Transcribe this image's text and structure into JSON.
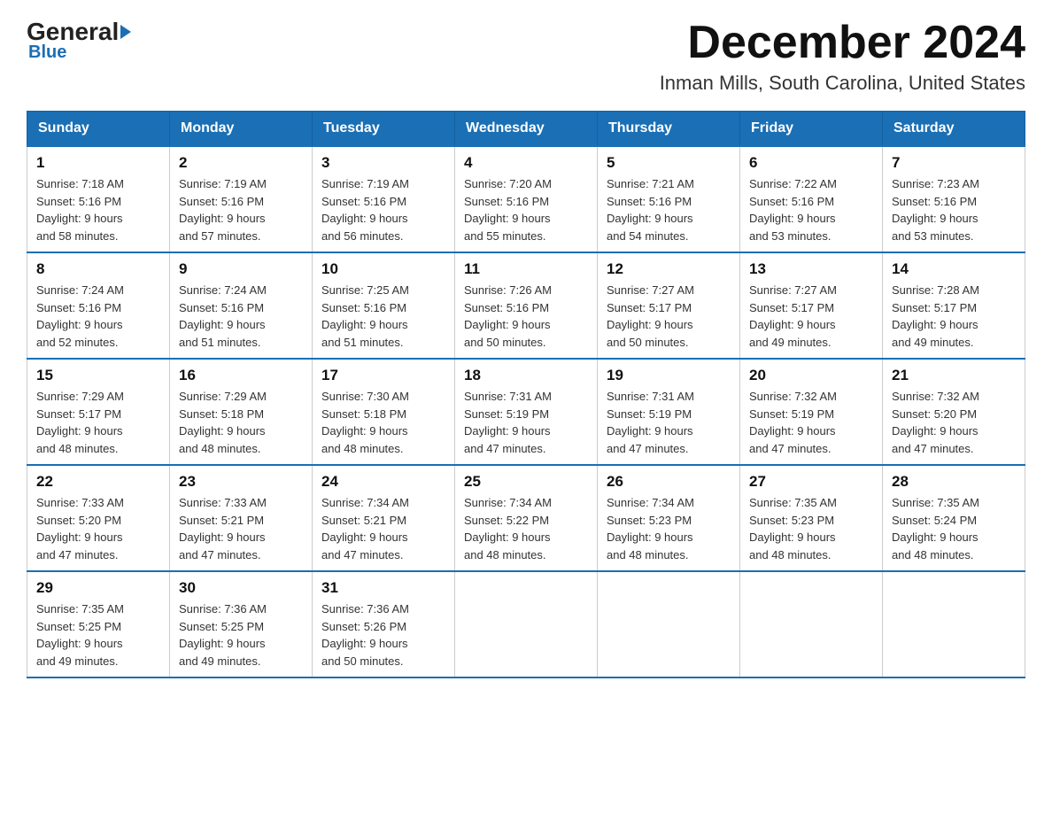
{
  "logo": {
    "general": "General",
    "blue": "Blue"
  },
  "header": {
    "month": "December 2024",
    "location": "Inman Mills, South Carolina, United States"
  },
  "days_of_week": [
    "Sunday",
    "Monday",
    "Tuesday",
    "Wednesday",
    "Thursday",
    "Friday",
    "Saturday"
  ],
  "weeks": [
    [
      {
        "day": "1",
        "sunrise": "7:18 AM",
        "sunset": "5:16 PM",
        "daylight": "9 hours and 58 minutes."
      },
      {
        "day": "2",
        "sunrise": "7:19 AM",
        "sunset": "5:16 PM",
        "daylight": "9 hours and 57 minutes."
      },
      {
        "day": "3",
        "sunrise": "7:19 AM",
        "sunset": "5:16 PM",
        "daylight": "9 hours and 56 minutes."
      },
      {
        "day": "4",
        "sunrise": "7:20 AM",
        "sunset": "5:16 PM",
        "daylight": "9 hours and 55 minutes."
      },
      {
        "day": "5",
        "sunrise": "7:21 AM",
        "sunset": "5:16 PM",
        "daylight": "9 hours and 54 minutes."
      },
      {
        "day": "6",
        "sunrise": "7:22 AM",
        "sunset": "5:16 PM",
        "daylight": "9 hours and 53 minutes."
      },
      {
        "day": "7",
        "sunrise": "7:23 AM",
        "sunset": "5:16 PM",
        "daylight": "9 hours and 53 minutes."
      }
    ],
    [
      {
        "day": "8",
        "sunrise": "7:24 AM",
        "sunset": "5:16 PM",
        "daylight": "9 hours and 52 minutes."
      },
      {
        "day": "9",
        "sunrise": "7:24 AM",
        "sunset": "5:16 PM",
        "daylight": "9 hours and 51 minutes."
      },
      {
        "day": "10",
        "sunrise": "7:25 AM",
        "sunset": "5:16 PM",
        "daylight": "9 hours and 51 minutes."
      },
      {
        "day": "11",
        "sunrise": "7:26 AM",
        "sunset": "5:16 PM",
        "daylight": "9 hours and 50 minutes."
      },
      {
        "day": "12",
        "sunrise": "7:27 AM",
        "sunset": "5:17 PM",
        "daylight": "9 hours and 50 minutes."
      },
      {
        "day": "13",
        "sunrise": "7:27 AM",
        "sunset": "5:17 PM",
        "daylight": "9 hours and 49 minutes."
      },
      {
        "day": "14",
        "sunrise": "7:28 AM",
        "sunset": "5:17 PM",
        "daylight": "9 hours and 49 minutes."
      }
    ],
    [
      {
        "day": "15",
        "sunrise": "7:29 AM",
        "sunset": "5:17 PM",
        "daylight": "9 hours and 48 minutes."
      },
      {
        "day": "16",
        "sunrise": "7:29 AM",
        "sunset": "5:18 PM",
        "daylight": "9 hours and 48 minutes."
      },
      {
        "day": "17",
        "sunrise": "7:30 AM",
        "sunset": "5:18 PM",
        "daylight": "9 hours and 48 minutes."
      },
      {
        "day": "18",
        "sunrise": "7:31 AM",
        "sunset": "5:19 PM",
        "daylight": "9 hours and 47 minutes."
      },
      {
        "day": "19",
        "sunrise": "7:31 AM",
        "sunset": "5:19 PM",
        "daylight": "9 hours and 47 minutes."
      },
      {
        "day": "20",
        "sunrise": "7:32 AM",
        "sunset": "5:19 PM",
        "daylight": "9 hours and 47 minutes."
      },
      {
        "day": "21",
        "sunrise": "7:32 AM",
        "sunset": "5:20 PM",
        "daylight": "9 hours and 47 minutes."
      }
    ],
    [
      {
        "day": "22",
        "sunrise": "7:33 AM",
        "sunset": "5:20 PM",
        "daylight": "9 hours and 47 minutes."
      },
      {
        "day": "23",
        "sunrise": "7:33 AM",
        "sunset": "5:21 PM",
        "daylight": "9 hours and 47 minutes."
      },
      {
        "day": "24",
        "sunrise": "7:34 AM",
        "sunset": "5:21 PM",
        "daylight": "9 hours and 47 minutes."
      },
      {
        "day": "25",
        "sunrise": "7:34 AM",
        "sunset": "5:22 PM",
        "daylight": "9 hours and 48 minutes."
      },
      {
        "day": "26",
        "sunrise": "7:34 AM",
        "sunset": "5:23 PM",
        "daylight": "9 hours and 48 minutes."
      },
      {
        "day": "27",
        "sunrise": "7:35 AM",
        "sunset": "5:23 PM",
        "daylight": "9 hours and 48 minutes."
      },
      {
        "day": "28",
        "sunrise": "7:35 AM",
        "sunset": "5:24 PM",
        "daylight": "9 hours and 48 minutes."
      }
    ],
    [
      {
        "day": "29",
        "sunrise": "7:35 AM",
        "sunset": "5:25 PM",
        "daylight": "9 hours and 49 minutes."
      },
      {
        "day": "30",
        "sunrise": "7:36 AM",
        "sunset": "5:25 PM",
        "daylight": "9 hours and 49 minutes."
      },
      {
        "day": "31",
        "sunrise": "7:36 AM",
        "sunset": "5:26 PM",
        "daylight": "9 hours and 50 minutes."
      },
      null,
      null,
      null,
      null
    ]
  ]
}
